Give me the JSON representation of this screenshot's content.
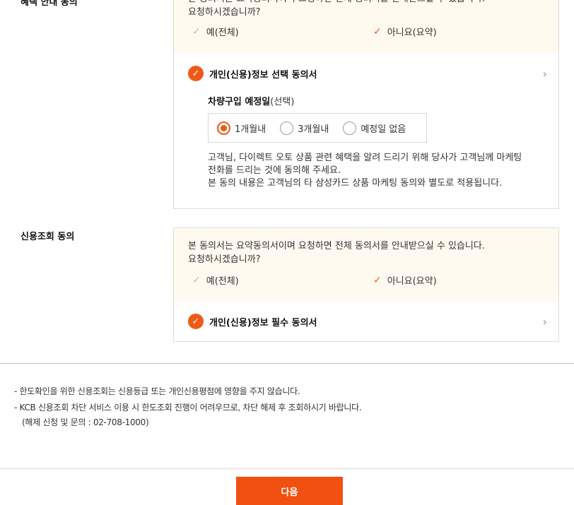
{
  "benefit_section": {
    "title": "혜택 안내 동의",
    "notice_line1": "본 동의서는 요약동의서이며 요청하면 전체 동의서를 안내받으실 수 있습니다.",
    "notice_line2": "요청하시겠습니까?",
    "option_full": "예(전체)",
    "option_summary": "아니요(요약)",
    "consent_label": "개인(신용)정보 선택 동의서",
    "purchase_date_label_bold": "차량구입 예정일",
    "purchase_date_label_suffix": "(선택)",
    "radios": [
      "1개월내",
      "3개월내",
      "예정일 없음"
    ],
    "selected_radio": "1개월내",
    "desc_line1": "고객님, 다이렉트 오토 상품 관련 혜택을 알려 드리기 위해 당사가 고객님께 마케팅",
    "desc_line2": "전화를 드리는 것에 동의해 주세요.",
    "desc_line3": "본 동의 내용은 고객님의 타 삼성카드 상품 마케팅 동의와 별도로 적용됩니다."
  },
  "credit_section": {
    "title": "신용조회 동의",
    "notice_line1": "본 동의서는 요약동의서이며 요청하면 전체 동의서를 안내받으실 수 있습니다.",
    "notice_line2": "요청하시겠습니까?",
    "option_full": "예(전체)",
    "option_summary": "아니요(요약)",
    "consent_label": "개인(신용)정보 필수 동의서"
  },
  "footnotes": {
    "line1": "한도확인을 위한 신용조회는 신용등급 또는 개인신용평점에 영향을 주지 않습니다.",
    "line2": "KCB 신용조회 차단 서비스 이용 시 한도조회 진행이 어려우므로, 차단 해제 후 조회하시기 바랍니다.",
    "line3": "(해제 신청 및 문의 : 02-708-1000)"
  },
  "next_button": "다음",
  "colors": {
    "accent": "#ee5a15",
    "notice_bg": "#fffaf0"
  }
}
